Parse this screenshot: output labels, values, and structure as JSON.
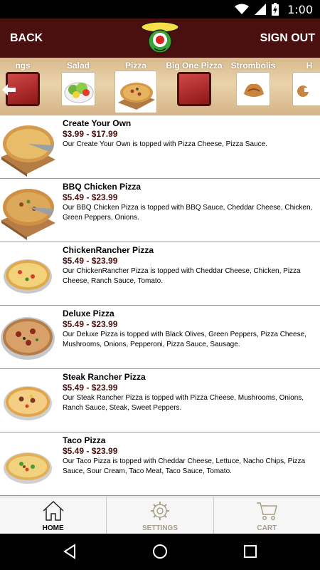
{
  "status_bar": {
    "time": "1:00",
    "icons": [
      "wifi-icon",
      "signal-icon",
      "battery-charging-icon"
    ]
  },
  "header": {
    "back_label": "BACK",
    "signout_label": "SIGN OUT",
    "logo_icon": "restaurant-logo-icon"
  },
  "categories": [
    {
      "label": "ngs",
      "thumb": "red"
    },
    {
      "label": "Salad",
      "thumb": "salad"
    },
    {
      "label": "Pizza",
      "thumb": "pizza",
      "selected": true
    },
    {
      "label": "Big One Pizza",
      "thumb": "red"
    },
    {
      "label": "Strombolis",
      "thumb": "stromboli"
    },
    {
      "label": "H",
      "thumb": "partial"
    }
  ],
  "menu_items": [
    {
      "name": "Create Your Own",
      "price": "$3.99 - $17.99",
      "description": "Our Create Your Own is topped with Pizza Cheese, Pizza Sauce."
    },
    {
      "name": "BBQ Chicken Pizza",
      "price": "$5.49 - $23.99",
      "description": "Our BBQ Chicken Pizza is topped with BBQ Sauce, Cheddar Cheese, Chicken, Green Peppers, Onions."
    },
    {
      "name": "ChickenRancher Pizza",
      "price": "$5.49 - $23.99",
      "description": "Our ChickenRancher Pizza is topped with Cheddar Cheese, Chicken, Pizza Cheese, Ranch Sauce, Tomato."
    },
    {
      "name": "Deluxe Pizza",
      "price": "$5.49 - $23.99",
      "description": "Our Deluxe Pizza is topped with Black Olives, Green Peppers, Pizza Cheese, Mushrooms, Onions, Pepperoni, Pizza Sauce, Sausage."
    },
    {
      "name": "Steak Rancher Pizza",
      "price": "$5.49 - $23.99",
      "description": "Our Steak Rancher Pizza is topped with Pizza Cheese, Mushrooms, Onions, Ranch Sauce, Steak, Sweet Peppers."
    },
    {
      "name": "Taco Pizza",
      "price": "$5.49 - $23.99",
      "description": "Our Taco Pizza is topped with Cheddar Cheese, Lettuce, Nacho Chips, Pizza Sauce, Sour Cream, Taco Meat, Taco Sauce, Tomato."
    }
  ],
  "tabs": [
    {
      "label": "HOME",
      "icon": "home-icon",
      "active": true
    },
    {
      "label": "SETTINGS",
      "icon": "gear-icon",
      "active": false
    },
    {
      "label": "CART",
      "icon": "cart-icon",
      "active": false
    }
  ],
  "colors": {
    "header_bg": "#4a0f0f",
    "price_text": "#4a0f0f",
    "strip_bg": "#e2c79b",
    "inactive_tab_text": "#a89e86"
  }
}
